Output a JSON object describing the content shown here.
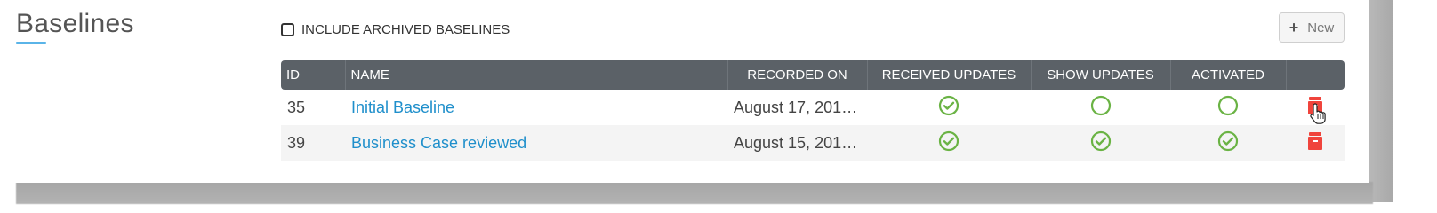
{
  "header": {
    "title": "Baselines",
    "include_archived_label": "INCLUDE ARCHIVED BASELINES",
    "include_archived_checked": false,
    "new_button_label": "New"
  },
  "table": {
    "columns": [
      "ID",
      "NAME",
      "RECORDED ON",
      "RECEIVED UPDATES",
      "SHOW UPDATES",
      "ACTIVATED",
      ""
    ],
    "rows": [
      {
        "id": "35",
        "name": "Initial Baseline",
        "recorded_on": "August 17, 201…",
        "received_updates": true,
        "show_updates": false,
        "activated": false
      },
      {
        "id": "39",
        "name": "Business Case reviewed",
        "recorded_on": "August 15, 201…",
        "received_updates": true,
        "show_updates": true,
        "activated": true
      }
    ]
  },
  "icons": {
    "check": "check-circle-icon",
    "empty": "empty-circle-icon",
    "delete": "trash-icon",
    "cursor": "hand-pointer-cursor"
  },
  "colors": {
    "accent_underline": "#5ab4e8",
    "header_bg": "#5b6167",
    "link": "#1f8fcb",
    "status_green": "#6ab344",
    "delete_red": "#f0443c"
  }
}
